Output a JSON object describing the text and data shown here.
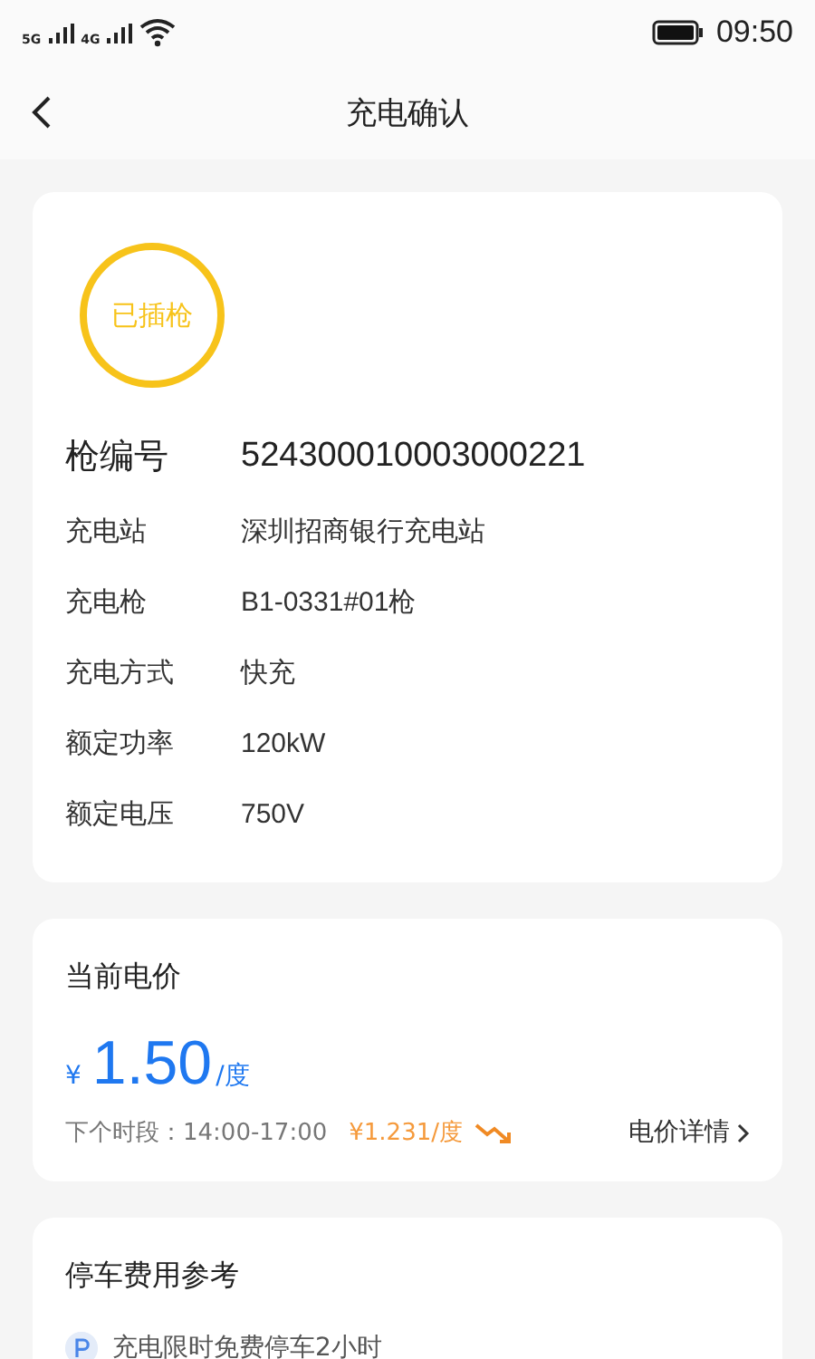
{
  "status_bar": {
    "network_1": "5G",
    "network_2": "4G",
    "time": "09:50"
  },
  "header": {
    "title": "充电确认"
  },
  "gun_card": {
    "status": "已插枪",
    "gun_number": {
      "label": "枪编号",
      "value": "524300010003000221"
    },
    "details": [
      {
        "label": "充电站",
        "value": "深圳招商银行充电站"
      },
      {
        "label": "充电枪",
        "value": "B1-0331#01枪"
      },
      {
        "label": "充电方式",
        "value": "快充"
      },
      {
        "label": "额定功率",
        "value": "120kW"
      },
      {
        "label": "额定电压",
        "value": "750V"
      }
    ]
  },
  "price_card": {
    "title": "当前电价",
    "currency": "¥",
    "price": "1.50",
    "unit": "/度",
    "next_period": "下个时段：14:00-17:00",
    "next_price": "¥1.231/度",
    "details_link": "电价详情"
  },
  "parking_card": {
    "title": "停车费用参考",
    "note": "充电限时免费停车2小时"
  }
}
